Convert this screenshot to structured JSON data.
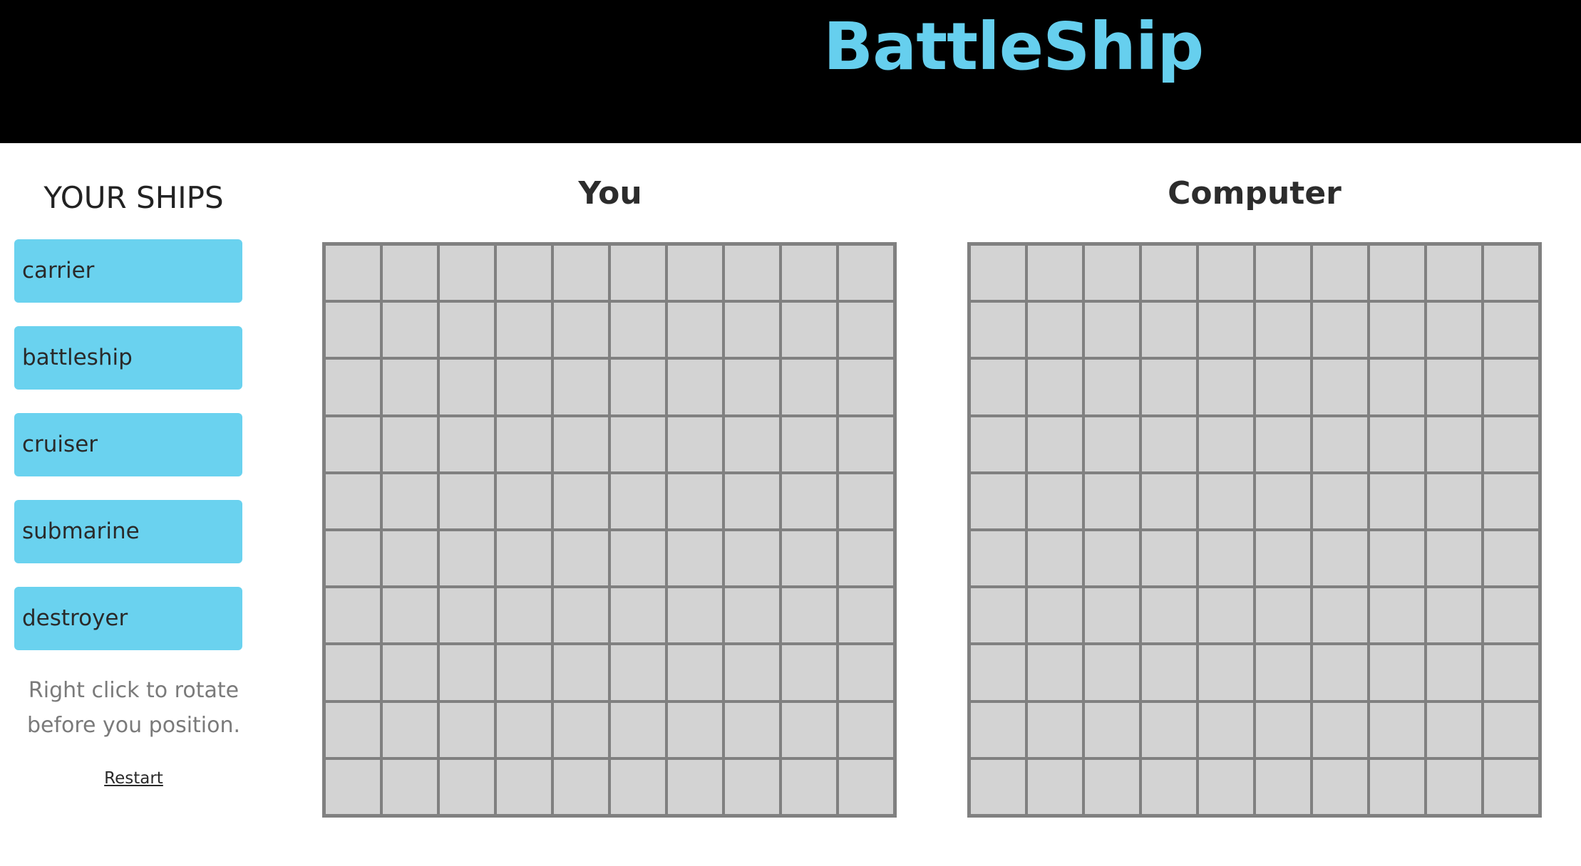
{
  "colors": {
    "header_bg": "#000000",
    "title": "#66cfee",
    "ship_bg": "#6ad2ef",
    "cell_bg": "#d3d3d3",
    "grid_line": "#808080"
  },
  "header": {
    "title": "BattleShip"
  },
  "sidebar": {
    "heading": "YOUR SHIPS",
    "ships": [
      {
        "label": "carrier"
      },
      {
        "label": "battleship"
      },
      {
        "label": "cruiser"
      },
      {
        "label": "submarine"
      },
      {
        "label": "destroyer"
      }
    ],
    "hint_line1": "Right click to rotate",
    "hint_line2": "before you position.",
    "restart_label": "Restart"
  },
  "boards": [
    {
      "title": "You",
      "rows": 10,
      "cols": 10
    },
    {
      "title": "Computer",
      "rows": 10,
      "cols": 10
    }
  ]
}
